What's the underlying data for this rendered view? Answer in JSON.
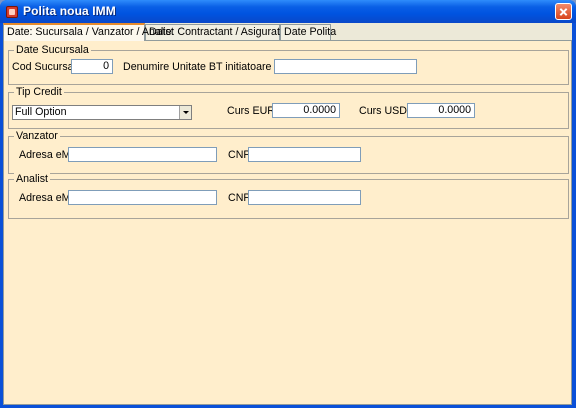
{
  "window": {
    "title": "Polita noua IMM"
  },
  "tabs": [
    "Date: Sucursala / Vanzator / Analist",
    "Date: Contractant / Asigurat / Bun",
    "Date Polita"
  ],
  "sucursala": {
    "legend": "Date Sucursala",
    "cod_label": "Cod Sucursala",
    "cod_value": "0",
    "denumire_label": "Denumire Unitate BT initiatoare a Politei",
    "denumire_value": ""
  },
  "credit": {
    "legend": "Tip Credit",
    "selected_option": "Full Option",
    "euro_label": "Curs EURO",
    "euro_value": "0.0000",
    "usd_label": "Curs USD",
    "usd_value": "0.0000"
  },
  "vanzator": {
    "legend": "Vanzator",
    "email_label": "Adresa eMail",
    "email_value": "",
    "cnp_label": "CNP",
    "cnp_value": ""
  },
  "analist": {
    "legend": "Analist",
    "email_label": "Adresa eMail",
    "email_value": "",
    "cnp_label": "CNP",
    "cnp_value": ""
  }
}
